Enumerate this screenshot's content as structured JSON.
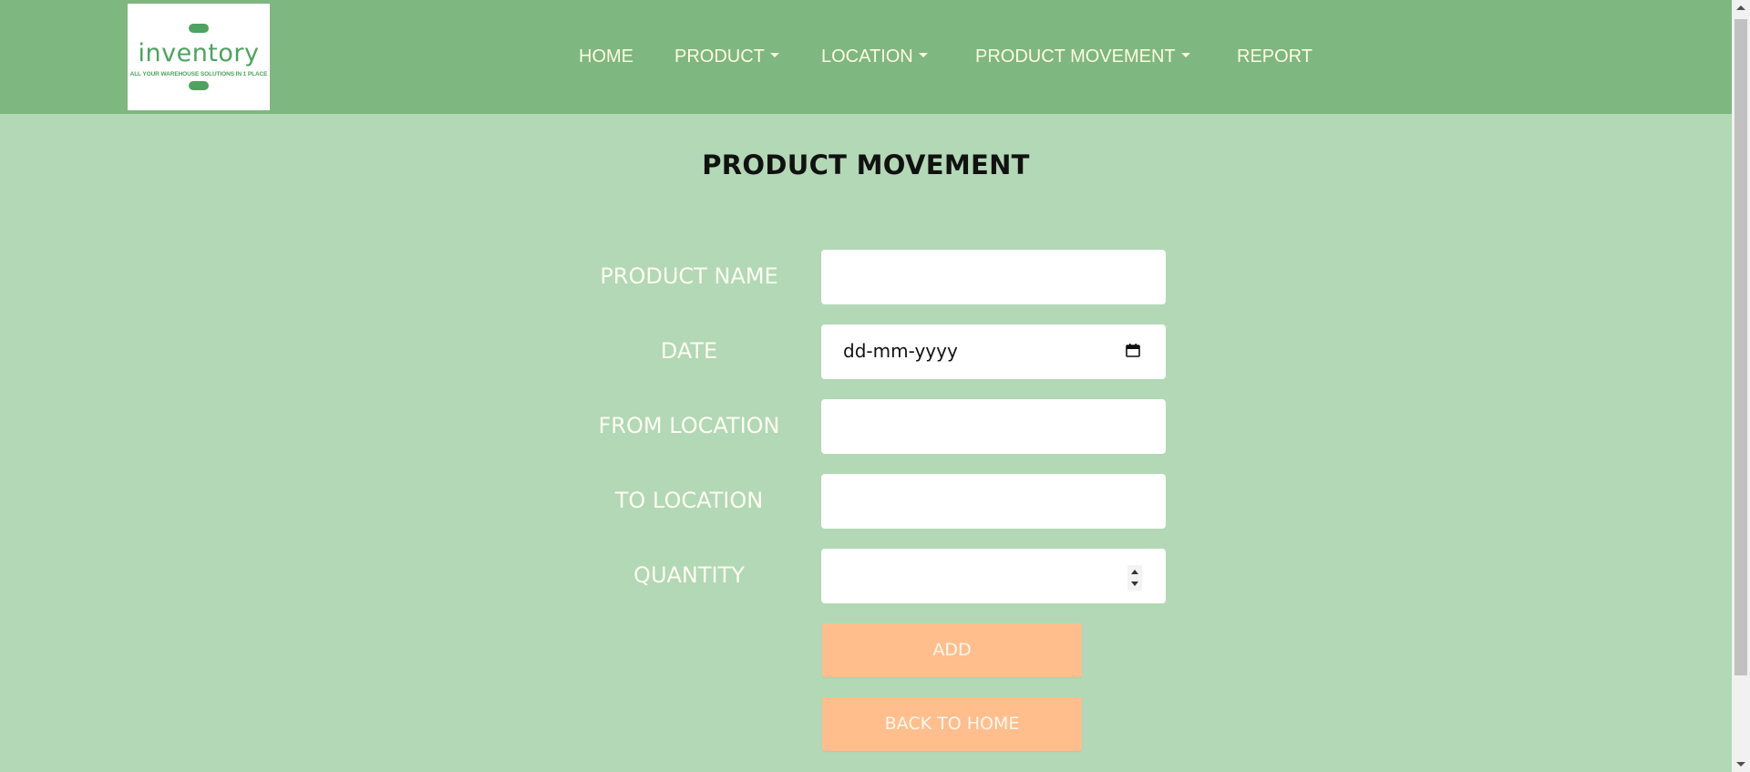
{
  "logo": {
    "word": "inventory",
    "tagline": "ALL YOUR WAREHOUSE SOLUTIONS IN 1 PLACE"
  },
  "nav": {
    "items": [
      {
        "label": "HOME",
        "dropdown": false
      },
      {
        "label": "PRODUCT",
        "dropdown": true
      },
      {
        "label": "LOCATION",
        "dropdown": true
      },
      {
        "label": "PRODUCT MOVEMENT",
        "dropdown": true
      },
      {
        "label": "REPORT",
        "dropdown": false
      }
    ]
  },
  "page": {
    "title": "PRODUCT MOVEMENT"
  },
  "form": {
    "product_name": {
      "label": "PRODUCT NAME",
      "value": ""
    },
    "date": {
      "label": "DATE",
      "placeholder": "dd-mm-yyyy"
    },
    "from_location": {
      "label": "FROM LOCATION",
      "value": ""
    },
    "to_location": {
      "label": "TO LOCATION",
      "value": ""
    },
    "quantity": {
      "label": "QUANTITY",
      "value": ""
    },
    "add_label": "ADD",
    "back_label": "BACK TO HOME"
  },
  "colors": {
    "navbar": "#7eb77f",
    "background": "#b2d8b5",
    "button": "#ffbe8c",
    "nav_text": "#fffbe0"
  },
  "icons": [
    "calendar-icon",
    "caret-down-icon",
    "spinner-icon"
  ]
}
